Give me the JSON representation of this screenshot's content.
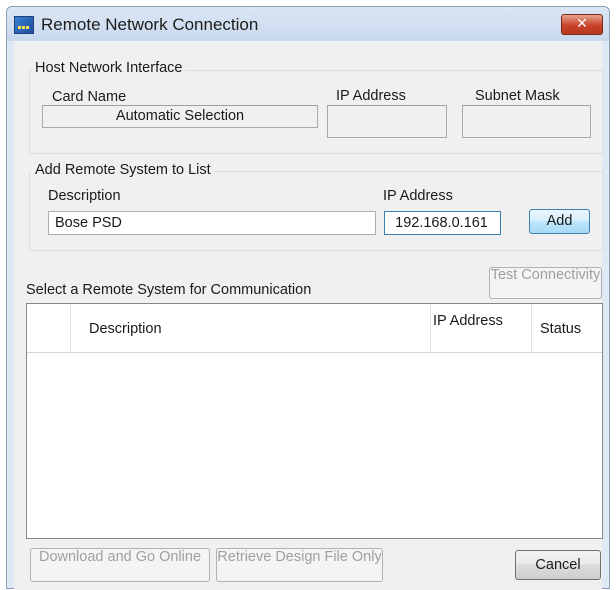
{
  "window": {
    "title": "Remote Network Connection",
    "close_label": "✕"
  },
  "host_network": {
    "group_title": "Host Network Interface",
    "card_name_label": "Card Name",
    "card_name_value": "Automatic Selection",
    "ip_label": "IP Address",
    "ip_value": "",
    "subnet_label": "Subnet Mask",
    "subnet_value": ""
  },
  "add_remote": {
    "group_title": "Add Remote System to List",
    "description_label": "Description",
    "description_value": "Bose PSD",
    "ip_label": "IP Address",
    "ip_value": "192.168.0.161",
    "add_button": "Add"
  },
  "select_remote": {
    "label": "Select a Remote System for Communication",
    "test_button": "Test Connectivity",
    "columns": [
      "",
      "Description",
      "IP Address",
      "Status"
    ],
    "rows": []
  },
  "footer": {
    "download_button": "Download and Go Online",
    "retrieve_button": "Retrieve Design File Only",
    "cancel_button": "Cancel"
  }
}
